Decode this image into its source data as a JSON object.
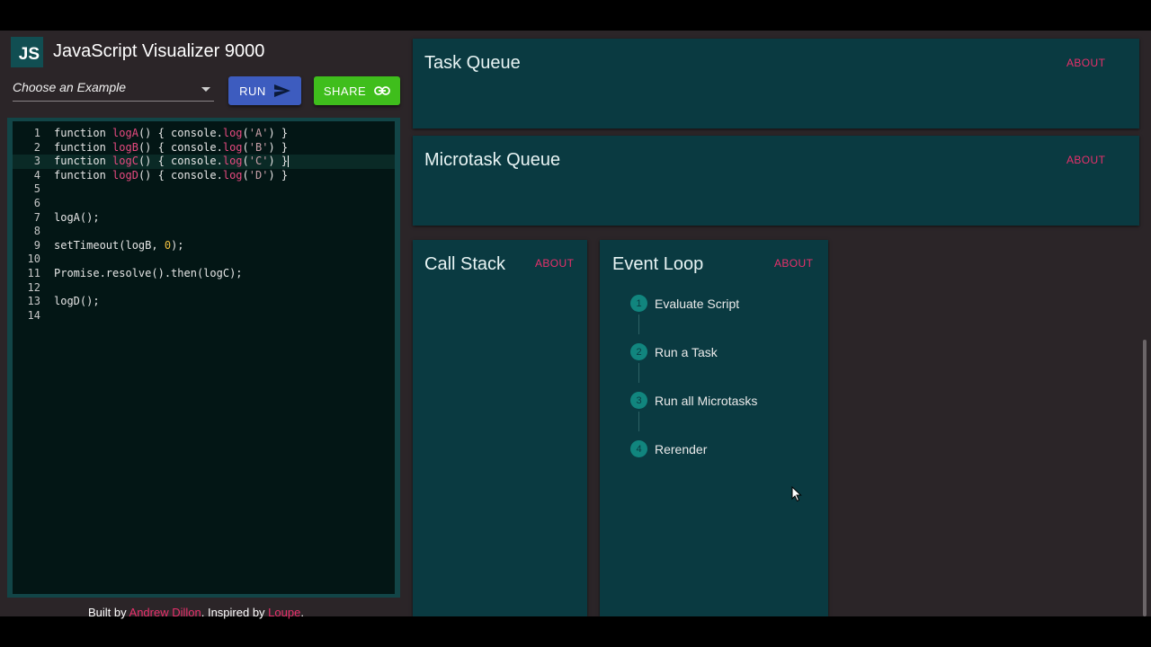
{
  "app": {
    "logo_text": "JS",
    "title": "JavaScript Visualizer 9000"
  },
  "toolbar": {
    "example_placeholder": "Choose an Example",
    "run_label": "RUN",
    "share_label": "SHARE"
  },
  "editor": {
    "lines": [
      {
        "n": "1",
        "tokens": [
          [
            "kw",
            "function "
          ],
          [
            "fn",
            "logA"
          ],
          [
            "kw",
            "() { console."
          ],
          [
            "fn",
            "log"
          ],
          [
            "kw",
            "("
          ],
          [
            "str",
            "'A'"
          ],
          [
            "kw",
            ") }"
          ]
        ]
      },
      {
        "n": "2",
        "tokens": [
          [
            "kw",
            "function "
          ],
          [
            "fn",
            "logB"
          ],
          [
            "kw",
            "() { console."
          ],
          [
            "fn",
            "log"
          ],
          [
            "kw",
            "("
          ],
          [
            "str",
            "'B'"
          ],
          [
            "kw",
            ") }"
          ]
        ]
      },
      {
        "n": "3",
        "tokens": [
          [
            "kw",
            "function "
          ],
          [
            "fn",
            "logC"
          ],
          [
            "kw",
            "() { console."
          ],
          [
            "fn",
            "log"
          ],
          [
            "kw",
            "("
          ],
          [
            "str",
            "'C'"
          ],
          [
            "kw",
            ") }"
          ]
        ],
        "active": true
      },
      {
        "n": "4",
        "tokens": [
          [
            "kw",
            "function "
          ],
          [
            "fn",
            "logD"
          ],
          [
            "kw",
            "() { console."
          ],
          [
            "fn",
            "log"
          ],
          [
            "kw",
            "("
          ],
          [
            "str",
            "'D'"
          ],
          [
            "kw",
            ") }"
          ]
        ]
      },
      {
        "n": "5",
        "tokens": []
      },
      {
        "n": "6",
        "tokens": []
      },
      {
        "n": "7",
        "tokens": [
          [
            "kw",
            "logA();"
          ]
        ]
      },
      {
        "n": "8",
        "tokens": []
      },
      {
        "n": "9",
        "tokens": [
          [
            "kw",
            "setTimeout(logB, "
          ],
          [
            "num",
            "0"
          ],
          [
            "kw",
            ");"
          ]
        ]
      },
      {
        "n": "10",
        "tokens": []
      },
      {
        "n": "11",
        "tokens": [
          [
            "kw",
            "Promise.resolve().then(logC);"
          ]
        ]
      },
      {
        "n": "12",
        "tokens": []
      },
      {
        "n": "13",
        "tokens": [
          [
            "kw",
            "logD();"
          ]
        ]
      },
      {
        "n": "14",
        "tokens": []
      }
    ]
  },
  "footer": {
    "prefix": "Built by ",
    "author": "Andrew Dillon",
    "middle": ". Inspired by ",
    "inspiration": "Loupe",
    "suffix": "."
  },
  "task_queue": {
    "title": "Task Queue",
    "about": "ABOUT"
  },
  "microtask_queue": {
    "title": "Microtask Queue",
    "about": "ABOUT"
  },
  "call_stack": {
    "title": "Call Stack",
    "about": "ABOUT"
  },
  "event_loop": {
    "title": "Event Loop",
    "about": "ABOUT",
    "steps": [
      {
        "num": "1",
        "label": "Evaluate Script"
      },
      {
        "num": "2",
        "label": "Run a Task"
      },
      {
        "num": "3",
        "label": "Run all Microtasks"
      },
      {
        "num": "4",
        "label": "Rerender"
      }
    ]
  },
  "icons": {
    "run": "send-arrow-icon",
    "share": "link-icon",
    "select": "chevron-down-icon"
  }
}
